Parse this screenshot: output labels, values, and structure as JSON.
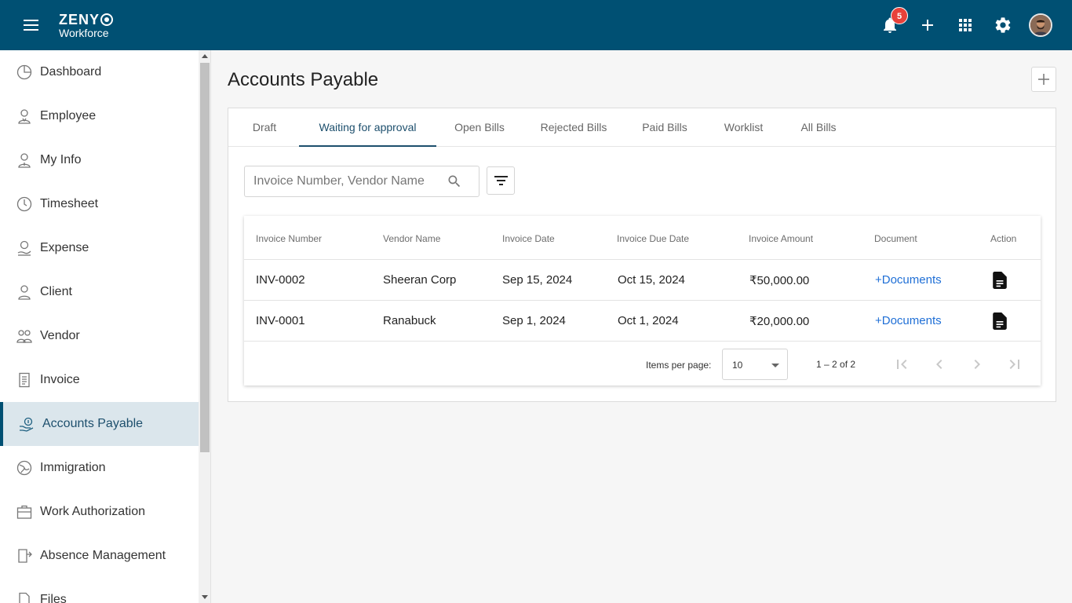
{
  "app": {
    "logo_line1": "ZENY",
    "logo_line2": "Workforce",
    "notification_count": "5"
  },
  "sidebar": {
    "items": [
      {
        "label": "Dashboard",
        "icon": "dashboard-icon"
      },
      {
        "label": "Employee",
        "icon": "employee-icon"
      },
      {
        "label": "My Info",
        "icon": "my-info-icon"
      },
      {
        "label": "Timesheet",
        "icon": "clock-icon"
      },
      {
        "label": "Expense",
        "icon": "expense-icon"
      },
      {
        "label": "Client",
        "icon": "person-icon"
      },
      {
        "label": "Vendor",
        "icon": "vendor-icon"
      },
      {
        "label": "Invoice",
        "icon": "invoice-icon"
      },
      {
        "label": "Accounts Payable",
        "icon": "handshake-money-icon",
        "active": true
      },
      {
        "label": "Immigration",
        "icon": "globe-icon"
      },
      {
        "label": "Work Authorization",
        "icon": "briefcase-icon"
      },
      {
        "label": "Absence Management",
        "icon": "door-exit-icon"
      },
      {
        "label": "Files",
        "icon": "file-icon"
      }
    ]
  },
  "page": {
    "title": "Accounts Payable"
  },
  "tabs": [
    {
      "label": "Draft"
    },
    {
      "label": "Waiting for approval",
      "active": true
    },
    {
      "label": "Open Bills"
    },
    {
      "label": "Rejected Bills"
    },
    {
      "label": "Paid Bills"
    },
    {
      "label": "Worklist"
    },
    {
      "label": "All Bills"
    }
  ],
  "search": {
    "placeholder": "Invoice Number, Vendor Name",
    "value": ""
  },
  "table": {
    "columns": [
      "Invoice Number",
      "Vendor Name",
      "Invoice Date",
      "Invoice Due Date",
      "Invoice Amount",
      "Document",
      "Action"
    ],
    "rows": [
      {
        "invoice_number": "INV-0002",
        "vendor": "Sheeran Corp",
        "invoice_date": "Sep 15, 2024",
        "due_date": "Oct 15, 2024",
        "amount": "₹50,000.00",
        "document": "+Documents"
      },
      {
        "invoice_number": "INV-0001",
        "vendor": "Ranabuck",
        "invoice_date": "Sep 1, 2024",
        "due_date": "Oct 1, 2024",
        "amount": "₹20,000.00",
        "document": "+Documents"
      }
    ]
  },
  "pagination": {
    "items_per_page_label": "Items per page:",
    "items_per_page": "10",
    "range": "1 – 2 of 2"
  },
  "colors": {
    "topbar": "#005073",
    "accent": "#1d4f6d",
    "link": "#1f6fd6",
    "badge": "#e8413a",
    "logo_orange": "#f58a1f"
  }
}
